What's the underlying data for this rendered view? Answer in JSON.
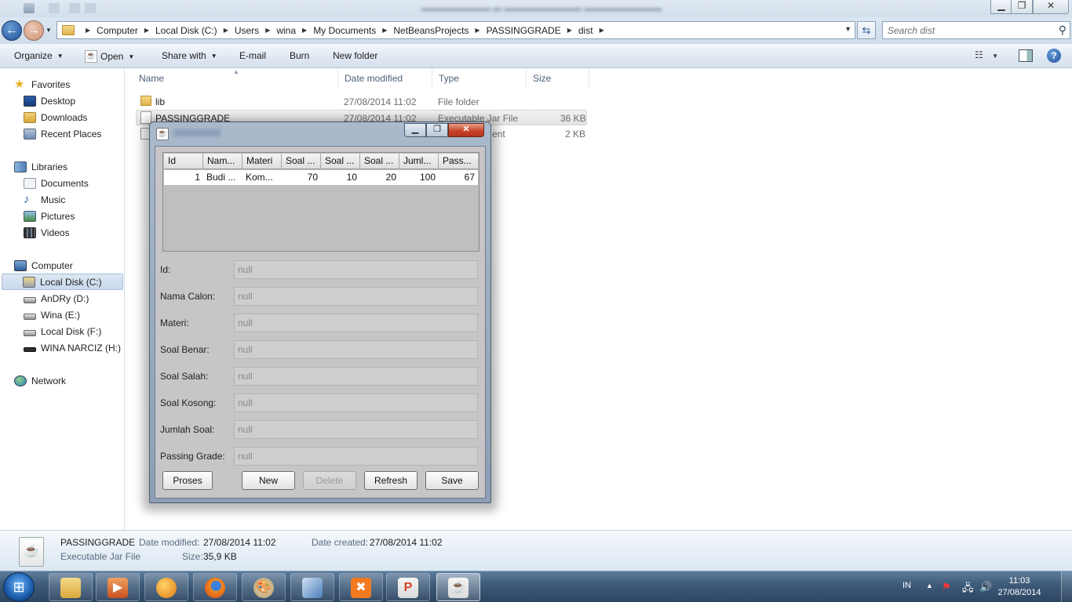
{
  "window": {
    "minimize_glyph": "▁",
    "maximize_glyph": "❐",
    "close_glyph": "✕"
  },
  "address": {
    "crumbs": [
      "Computer",
      "Local Disk (C:)",
      "Users",
      "wina",
      "My Documents",
      "NetBeansProjects",
      "PASSINGGRADE",
      "dist"
    ],
    "search_placeholder": "Search dist"
  },
  "toolbar": {
    "organize": "Organize",
    "open": "Open",
    "share_with": "Share with",
    "email": "E-mail",
    "burn": "Burn",
    "new_folder": "New folder"
  },
  "sidebar": {
    "favorites": "Favorites",
    "desktop": "Desktop",
    "downloads": "Downloads",
    "recent_places": "Recent Places",
    "libraries": "Libraries",
    "documents": "Documents",
    "music": "Music",
    "pictures": "Pictures",
    "videos": "Videos",
    "computer": "Computer",
    "local_disk_c": "Local Disk (C:)",
    "andry_d": "AnDRy (D:)",
    "wina_e": "Wina (E:)",
    "local_disk_f": "Local Disk (F:)",
    "wina_narciz_h": "WINA NARCIZ (H:)",
    "network": "Network"
  },
  "filelist": {
    "columns": {
      "name": "Name",
      "date_modified": "Date modified",
      "type": "Type",
      "size": "Size"
    },
    "files": [
      {
        "name": "lib",
        "date": "27/08/2014 11:02",
        "type": "File folder",
        "size": ""
      },
      {
        "name": "PASSINGGRADE",
        "date": "27/08/2014 11:02",
        "type": "Executable Jar File",
        "size": "36 KB"
      },
      {
        "name": "",
        "date": "",
        "type": "ent",
        "size": "2 KB"
      }
    ]
  },
  "details": {
    "name": "PASSINGGRADE",
    "type": "Executable Jar File",
    "date_modified_label": "Date modified:",
    "date_modified": "27/08/2014 11:02",
    "date_created_label": "Date created:",
    "date_created": "27/08/2014 11:02",
    "size_label": "Size:",
    "size": "35,9 KB"
  },
  "taskbar": {
    "lang": "IN",
    "time": "11:03",
    "date": "27/08/2014"
  },
  "dialog": {
    "table": {
      "headers": [
        "Id",
        "Nam...",
        "Materi",
        "Soal ...",
        "Soal ...",
        "Soal ...",
        "Juml...",
        "Pass..."
      ],
      "rows": [
        [
          "1",
          "Budi ...",
          "Kom...",
          "70",
          "10",
          "20",
          "100",
          "67"
        ]
      ]
    },
    "form": {
      "id_label": "Id:",
      "nama_calon_label": "Nama Calon:",
      "materi_label": "Materi:",
      "soal_benar_label": "Soal Benar:",
      "soal_salah_label": "Soal Salah:",
      "soal_kosong_label": "Soal Kosong:",
      "jumlah_soal_label": "Jumlah Soal:",
      "passing_grade_label": "Passing Grade:",
      "field_placeholder": "null"
    },
    "buttons": {
      "proses": "Proses",
      "new": "New",
      "delete": "Delete",
      "refresh": "Refresh",
      "save": "Save"
    }
  }
}
